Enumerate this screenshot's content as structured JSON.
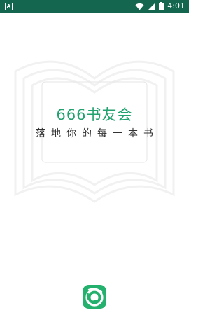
{
  "status_bar": {
    "left_icon_letter": "A",
    "time": "4:01",
    "icons": [
      "wifi-icon",
      "signal-icon",
      "battery-icon"
    ]
  },
  "splash": {
    "title": "666书友会",
    "slogan": "落地你的每一本书"
  },
  "colors": {
    "status_bar": "#14664f",
    "brand_green": "#21a26e",
    "logo_bg": "#24b06d",
    "background": "#ffffff"
  }
}
